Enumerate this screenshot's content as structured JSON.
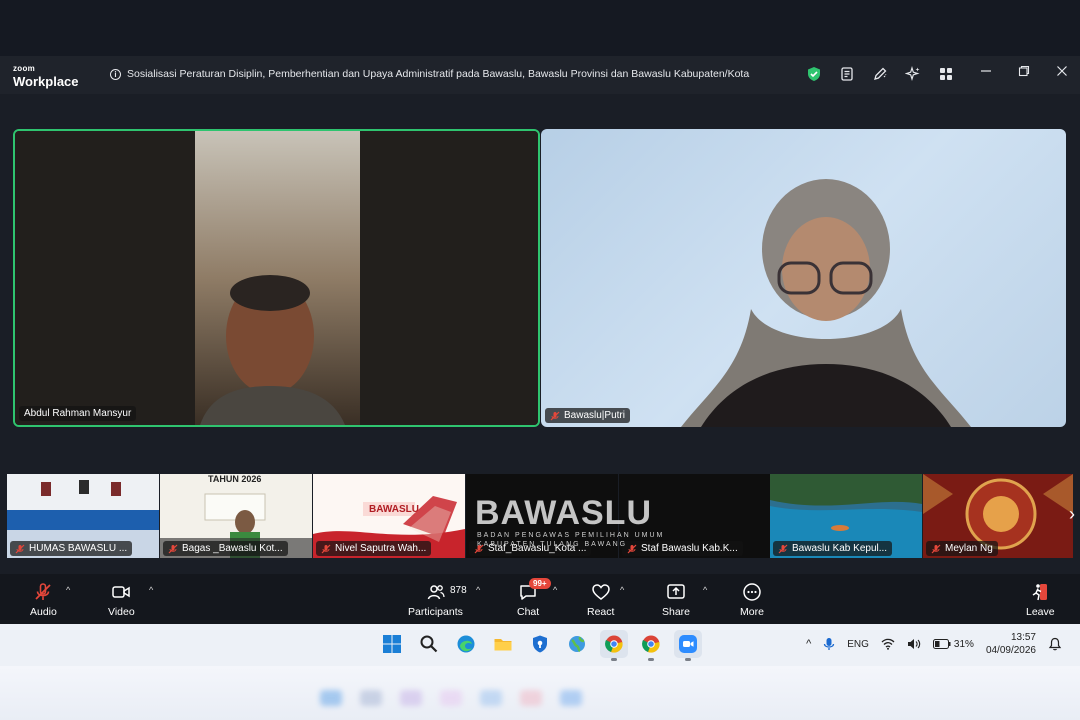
{
  "app": {
    "brand_small": "zoom",
    "brand_large": "Workplace"
  },
  "meeting": {
    "title": "Sosialisasi Peraturan Disiplin, Pemberhentian dan Upaya Administratif pada Bawaslu, Bawaslu Provinsi dan Bawaslu Kabupaten/Kota"
  },
  "titlebar_icons": [
    "shield-check-icon",
    "notes-icon",
    "pen-icon",
    "ai-sparkle-icon",
    "apps-grid-icon"
  ],
  "main_tiles": [
    {
      "name": "Abdul Rahman Mansyur",
      "muted": false,
      "speaking": true
    },
    {
      "name": "Bawaslu|Putri",
      "muted": true,
      "speaking": false
    }
  ],
  "thumbs": [
    {
      "name": "HUMAS BAWASLU ...",
      "muted": true
    },
    {
      "name": "Bagas _Bawaslu Kot...",
      "muted": true,
      "caption": "TAHUN 2026"
    },
    {
      "name": "Nivel Saputra Wah...",
      "muted": true,
      "caption": "BAWASLU"
    },
    {
      "name": "Staf_Bawaslu_Kota ...",
      "muted": true
    },
    {
      "name": "Staf Bawaslu Kab.K...",
      "muted": true
    },
    {
      "name": "Bawaslu Kab Kepul...",
      "muted": true
    },
    {
      "name": "Meylan Ng",
      "muted": true
    }
  ],
  "overlay_logo": {
    "text": "BAWASLU",
    "sub": "BADAN PENGAWAS PEMILIHAN UMUM",
    "sub2": "KABUPATEN TULANG BAWANG"
  },
  "toolbar": {
    "audio": "Audio",
    "video": "Video",
    "participants": "Participants",
    "participants_count": "878",
    "chat": "Chat",
    "chat_badge": "99+",
    "react": "React",
    "share": "Share",
    "more": "More",
    "leave": "Leave"
  },
  "taskbar": {
    "lang": "ENG",
    "battery": "31%",
    "time": "13:57",
    "date": "04/09/2026"
  },
  "colors": {
    "speaking_border": "#2fc46f",
    "badge": "#e5473b",
    "leave": "#e5473b"
  }
}
